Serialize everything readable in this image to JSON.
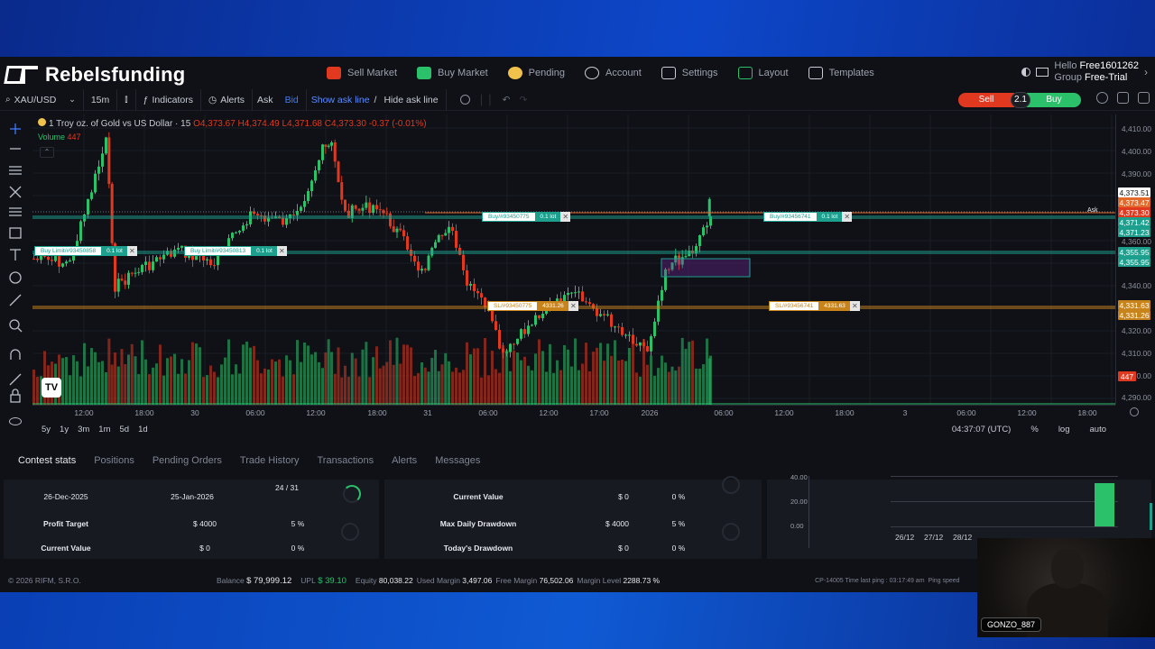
{
  "brand": {
    "name": "Rebelsfunding"
  },
  "nav": [
    {
      "label": "Sell Market",
      "icon": "sell-market-icon",
      "color": "#e0391f"
    },
    {
      "label": "Buy Market",
      "icon": "buy-market-icon",
      "color": "#2bc16b"
    },
    {
      "label": "Pending",
      "icon": "clock-icon",
      "color": "#f0c24b"
    },
    {
      "label": "Account",
      "icon": "user-icon",
      "color": "#c9ccd4"
    },
    {
      "label": "Settings",
      "icon": "gear-icon",
      "color": "#c9ccd4"
    },
    {
      "label": "Layout",
      "icon": "layout-icon",
      "color": "#2bc16b"
    },
    {
      "label": "Templates",
      "icon": "template-icon",
      "color": "#c9ccd4"
    }
  ],
  "user": {
    "hello": "Hello",
    "name": "Free1601262",
    "group_label": "Group",
    "group": "Free-Trial"
  },
  "toolbar": {
    "symbol": "XAU/USD",
    "interval": "15m",
    "indicators": "Indicators",
    "alerts": "Alerts",
    "ask": "Ask",
    "bid": "Bid",
    "show_ask": "Show ask line",
    "slash": "/",
    "hide_ask": "Hide ask line",
    "sell": "Sell",
    "spread": "2.1",
    "buy": "Buy"
  },
  "chart": {
    "legend_symbol": "1 Troy oz. of Gold vs US Dollar · 15",
    "legend_ohlc": "O4,373.67  H4,374.49  L4,371.68  C4,373.30  -0.37 (-0.01%)",
    "volume_label": "Volume",
    "volume_value": "447",
    "price_ticks": [
      "4,410.00",
      "4,400.00",
      "4,390.00",
      "4,360.00",
      "4,340.00",
      "4,320.00",
      "4,310.00",
      "4,300.00",
      "4,290.00"
    ],
    "price_tags": [
      {
        "text": "4,373.51",
        "color": "#ffffff",
        "fg": "#111"
      },
      {
        "text": "4,373.47",
        "color": "#e36a2a",
        "fg": "#fff"
      },
      {
        "text": "4,373.30",
        "color": "#e0391f",
        "fg": "#fff"
      },
      {
        "text": "4,371.42",
        "color": "#1d9f8e",
        "fg": "#fff"
      },
      {
        "text": "4,371.23",
        "color": "#1d9f8e",
        "fg": "#fff"
      },
      {
        "text": "4,355.95",
        "color": "#1d9f8e",
        "fg": "#fff"
      },
      {
        "text": "4,355.95",
        "color": "#1d9f8e",
        "fg": "#fff"
      },
      {
        "text": "4,331.63",
        "color": "#c8841b",
        "fg": "#fff"
      },
      {
        "text": "4,331.26",
        "color": "#c8841b",
        "fg": "#fff"
      },
      {
        "text": "447",
        "color": "#e0391f",
        "fg": "#fff"
      }
    ],
    "ask_label": "Ask",
    "time_ticks": [
      "12:00",
      "18:00",
      "30",
      "06:00",
      "12:00",
      "18:00",
      "31",
      "06:00",
      "12:00",
      "17:00",
      "2026",
      "06:00",
      "12:00",
      "18:00",
      "3",
      "06:00",
      "12:00",
      "18:00"
    ],
    "orders": [
      {
        "kind": "buy",
        "label": "Buy Limit/#93450858",
        "lot": "0.1 lot",
        "pnl": ""
      },
      {
        "kind": "buy",
        "label": "Buy Limit/#93450813",
        "lot": "0.1 lot",
        "pnl": ""
      },
      {
        "kind": "buy",
        "label": "Buy/#93450775",
        "lot": "0.1 lot",
        "pnl": ""
      },
      {
        "kind": "buy",
        "label": "Buy/#93456741",
        "lot": "0.1 lot",
        "pnl": ""
      },
      {
        "kind": "sl",
        "label": "SL/#93450775",
        "lot": "4331.26",
        "pnl": ""
      },
      {
        "kind": "sl",
        "label": "SL/#93456741",
        "lot": "4331.63",
        "pnl": ""
      }
    ]
  },
  "range_buttons": [
    "5y",
    "1y",
    "3m",
    "1m",
    "5d",
    "1d"
  ],
  "clock": {
    "time": "04:37:07 (UTC)",
    "pct": "%",
    "log": "log",
    "auto": "auto"
  },
  "tabs": [
    "Contest stats",
    "Positions",
    "Pending Orders",
    "Trade History",
    "Transactions",
    "Alerts",
    "Messages"
  ],
  "stats": {
    "start": "26-Dec-2025",
    "end": "25-Jan-2026",
    "days": "24 / 31",
    "profit_target_label": "Profit Target",
    "profit_target_value": "$ 4000",
    "profit_target_pct": "5 %",
    "current_value_label": "Current Value",
    "current_value_value": "$ 0",
    "current_value_pct": "0 %",
    "max_dd_label": "Max Daily Drawdown",
    "max_dd_value": "$ 4000",
    "max_dd_pct": "5 %",
    "cv2_label": "Current Value",
    "cv2_value": "$ 0",
    "cv2_pct": "0 %",
    "today_dd_label": "Today's Drawdown",
    "today_dd_value": "$ 0",
    "today_dd_pct": "0 %"
  },
  "mini_chart": {
    "y_ticks": [
      "40.00",
      "20.00",
      "0.00"
    ],
    "x_ticks": [
      "26/12",
      "27/12",
      "28/12"
    ]
  },
  "footer": {
    "copyright": "© 2026 RIFM, S.R.O.",
    "balance_label": "Balance",
    "balance": "$ 79,999.12",
    "upl_label": "UPL",
    "upl": "$ 39.10",
    "equity_label": "Equity",
    "equity": "80,038.22",
    "used_margin_label": "Used Margin",
    "used_margin": "3,497.06",
    "free_margin_label": "Free Margin",
    "free_margin": "76,502.06",
    "margin_level_label": "Margin Level",
    "margin_level": "2288.73 %",
    "ping": "CP-14005 Time last ping : 03:17:49 am",
    "ping_speed": "Ping speed"
  },
  "webcam": {
    "name": "GONZO_887"
  },
  "colors": {
    "up": "#2bc16b",
    "down": "#e0391f",
    "teal": "#1d9f8e",
    "orange": "#c8841b",
    "bg": "#0f1117"
  }
}
